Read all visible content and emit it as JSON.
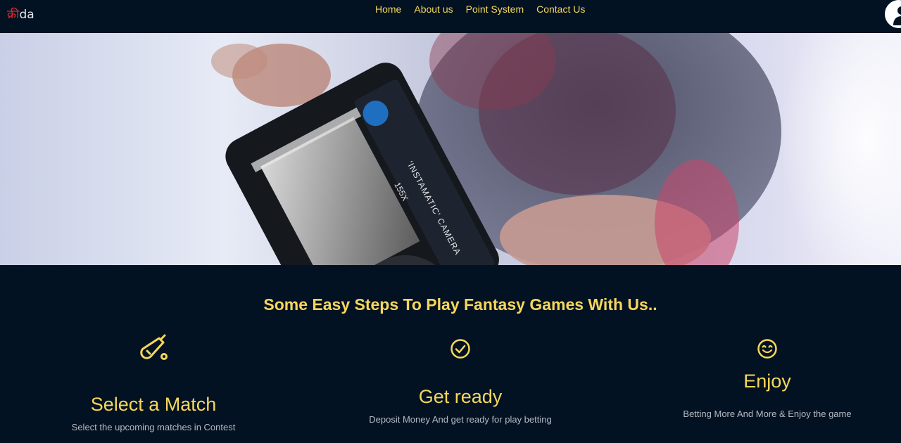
{
  "header": {
    "logo_devanagari": "क्री",
    "logo_latin": "da",
    "nav": [
      {
        "label": "Home"
      },
      {
        "label": "About us"
      },
      {
        "label": "Point System"
      },
      {
        "label": "Contact Us"
      }
    ],
    "avatar_icon": "user-icon"
  },
  "hero": {
    "camera_badge": "155X",
    "camera_text": "'INSTAMATIC' CAMERA"
  },
  "steps": {
    "heading": "Some Easy Steps To Play Fantasy Games With Us..",
    "items": [
      {
        "icon": "cricket-bat-ball-icon",
        "title": "Select a Match",
        "description": "Select the upcoming matches in Contest"
      },
      {
        "icon": "check-circle-icon",
        "title": "Get ready",
        "description": "Deposit Money And get ready for play betting"
      },
      {
        "icon": "smile-icon",
        "title": "Enjoy",
        "description": "Betting More And More & Enjoy the game"
      }
    ]
  },
  "colors": {
    "background": "#031222",
    "accent": "#f6d75c",
    "logo_red": "#e0292f",
    "muted_text": "#b6bac2"
  }
}
